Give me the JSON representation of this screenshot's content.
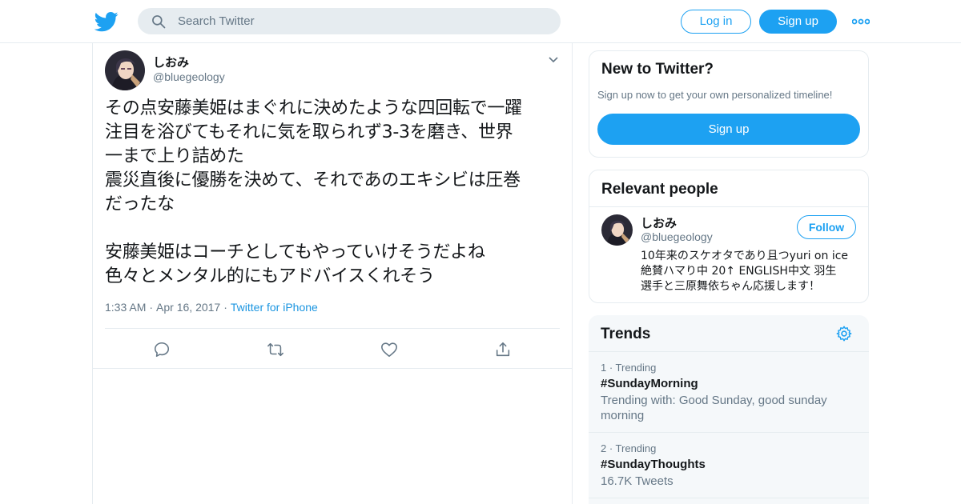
{
  "header": {
    "search_placeholder": "Search Twitter",
    "login_label": "Log in",
    "signup_label": "Sign up",
    "brand_color": "#1da1f2"
  },
  "tweet": {
    "display_name": "しおみ",
    "handle": "@bluegeology",
    "text": "その点安藤美姫はまぐれに決めたような四回転で一躍\n注目を浴びてもそれに気を取られず3-3を磨き、世界\n一まで上り詰めた\n震災直後に優勝を決めて、それであのエキシビは圧巻\nだったな\n\n安藤美姫はコーチとしてもやっていけそうだよね\n色々とメンタル的にもアドバイスくれそう",
    "time": "1:33 AM",
    "date": "Apr 16, 2017",
    "source": "Twitter for iPhone",
    "dot": "·"
  },
  "sidebar": {
    "new_to_twitter": {
      "title": "New to Twitter?",
      "subtitle": "Sign up now to get your own personalized timeline!",
      "button_label": "Sign up"
    },
    "relevant_people": {
      "title": "Relevant people",
      "name": "しおみ",
      "handle": "@bluegeology",
      "follow_label": "Follow",
      "bio": "10年来のスケオタであり且つyuri on ice\n絶賛ハマり中 20↑ ENGLISH中文 羽生\n選手と三原舞依ちゃん応援します！"
    },
    "trends": {
      "title": "Trends",
      "items": [
        {
          "rank": "1 · Trending",
          "tag": "#SundayMorning",
          "desc": "Trending with: Good Sunday, good sunday morning"
        },
        {
          "rank": "2 · Trending",
          "tag": "#SundayThoughts",
          "desc": "16.7K Tweets"
        }
      ]
    }
  }
}
